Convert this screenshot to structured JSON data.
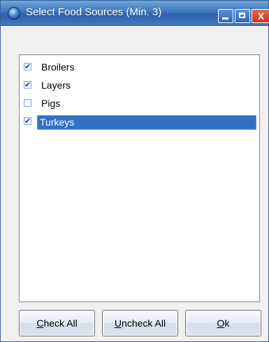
{
  "window": {
    "title": "Select Food Sources (Min. 3)",
    "close_glyph": "X"
  },
  "list": {
    "items": [
      {
        "label": "Broilers",
        "checked": true,
        "selected": false
      },
      {
        "label": "Layers",
        "checked": true,
        "selected": false
      },
      {
        "label": "Pigs",
        "checked": false,
        "selected": false
      },
      {
        "label": "Turkeys",
        "checked": true,
        "selected": true
      }
    ]
  },
  "buttons": {
    "check_all": {
      "mnemonic": "C",
      "rest": "heck All"
    },
    "uncheck_all": {
      "mnemonic": "U",
      "rest": "ncheck All"
    },
    "ok": {
      "mnemonic": "O",
      "rest": "k"
    }
  },
  "colors": {
    "selection": "#3270c8",
    "titlebar": "#3f77bd",
    "close_button": "#c8321d"
  }
}
